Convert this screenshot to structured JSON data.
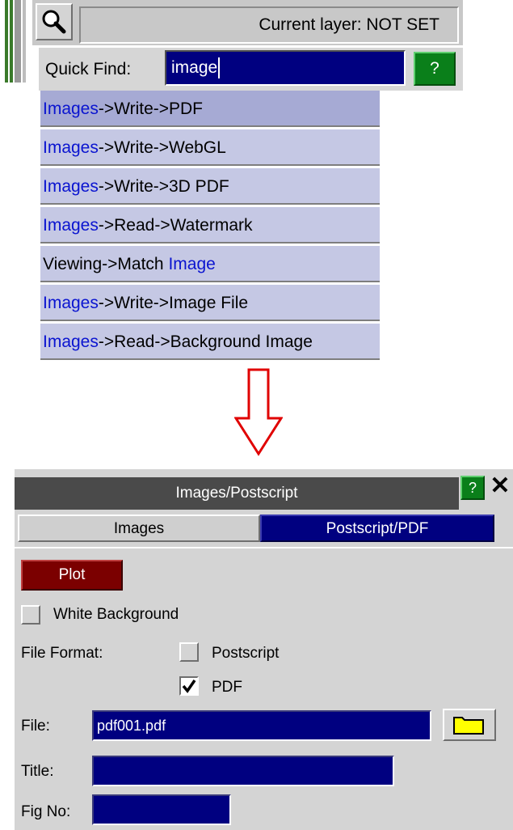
{
  "toolbar": {
    "current_layer": "Current layer: NOT SET"
  },
  "quick_find": {
    "label": "Quick Find:",
    "value": "image",
    "help": "?"
  },
  "results": [
    {
      "prefix": "",
      "highlight": "Images",
      "rest": "->Write->PDF",
      "selected": true
    },
    {
      "prefix": "",
      "highlight": "Images",
      "rest": "->Write->WebGL"
    },
    {
      "prefix": "",
      "highlight": "Images",
      "rest": "->Write->3D PDF"
    },
    {
      "prefix": "",
      "highlight": "Images",
      "rest": "->Read->Watermark"
    },
    {
      "prefix": "Viewing->Match ",
      "highlight": "Image",
      "rest": ""
    },
    {
      "prefix": "",
      "highlight": "Images",
      "rest": "->Write->Image File"
    },
    {
      "prefix": "",
      "highlight": "Images",
      "rest": "->Read->Background Image"
    }
  ],
  "dialog": {
    "title": "Images/Postscript",
    "help": "?",
    "close": "✕",
    "tabs": [
      "Images",
      "Postscript/PDF"
    ],
    "plot_label": "Plot",
    "white_background_label": "White Background",
    "file_format_label": "File Format:",
    "format_options": [
      "Postscript",
      "PDF"
    ],
    "file_label": "File:",
    "file_value": "pdf001.pdf",
    "title_label": "Title:",
    "title_value": "",
    "fig_no_label": "Fig No:",
    "fig_no_value": ""
  },
  "colors": {
    "accent_blue": "#000080",
    "highlight_text": "#0a14d0",
    "help_green": "#0a7f1a",
    "plot_red": "#7b0000",
    "arrow_red": "#e00000"
  },
  "icons": [
    "search-icon",
    "help-icon",
    "close-icon",
    "folder-icon",
    "checkmark-icon",
    "down-arrow-icon"
  ]
}
